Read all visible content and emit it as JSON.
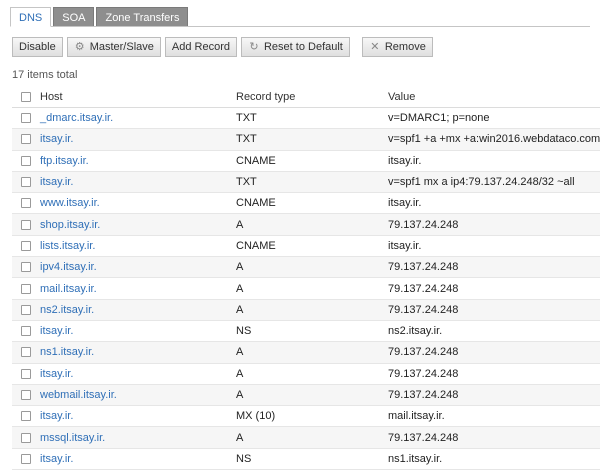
{
  "tabs": [
    {
      "label": "DNS",
      "active": true
    },
    {
      "label": "SOA",
      "active": false
    },
    {
      "label": "Zone Transfers",
      "active": false
    }
  ],
  "toolbar": {
    "disable": "Disable",
    "master_slave": "Master/Slave",
    "add_record": "Add Record",
    "reset_default": "Reset to Default",
    "remove": "Remove"
  },
  "total_text": "17 items total",
  "columns": {
    "host": "Host",
    "type": "Record type",
    "value": "Value"
  },
  "rows": [
    {
      "host": "_dmarc.itsay.ir.",
      "type": "TXT",
      "value": "v=DMARC1; p=none"
    },
    {
      "host": "itsay.ir.",
      "type": "TXT",
      "value": "v=spf1 +a +mx +a:win2016.webdataco.com -all"
    },
    {
      "host": "ftp.itsay.ir.",
      "type": "CNAME",
      "value": "itsay.ir."
    },
    {
      "host": "itsay.ir.",
      "type": "TXT",
      "value": "v=spf1 mx a ip4:79.137.24.248/32 ~all"
    },
    {
      "host": "www.itsay.ir.",
      "type": "CNAME",
      "value": "itsay.ir."
    },
    {
      "host": "shop.itsay.ir.",
      "type": "A",
      "value": "79.137.24.248"
    },
    {
      "host": "lists.itsay.ir.",
      "type": "CNAME",
      "value": "itsay.ir."
    },
    {
      "host": "ipv4.itsay.ir.",
      "type": "A",
      "value": "79.137.24.248"
    },
    {
      "host": "mail.itsay.ir.",
      "type": "A",
      "value": "79.137.24.248"
    },
    {
      "host": "ns2.itsay.ir.",
      "type": "A",
      "value": "79.137.24.248"
    },
    {
      "host": "itsay.ir.",
      "type": "NS",
      "value": "ns2.itsay.ir."
    },
    {
      "host": "ns1.itsay.ir.",
      "type": "A",
      "value": "79.137.24.248"
    },
    {
      "host": "itsay.ir.",
      "type": "A",
      "value": "79.137.24.248"
    },
    {
      "host": "webmail.itsay.ir.",
      "type": "A",
      "value": "79.137.24.248"
    },
    {
      "host": "itsay.ir.",
      "type": "MX (10)",
      "value": "mail.itsay.ir."
    },
    {
      "host": "mssql.itsay.ir.",
      "type": "A",
      "value": "79.137.24.248"
    },
    {
      "host": "itsay.ir.",
      "type": "NS",
      "value": "ns1.itsay.ir."
    }
  ]
}
